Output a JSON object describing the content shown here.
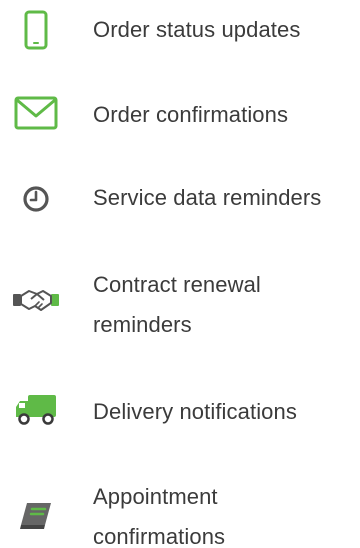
{
  "features": {
    "items": [
      {
        "icon": "smartphone-icon",
        "label": "Order status updates"
      },
      {
        "icon": "envelope-icon",
        "label": "Order confirmations"
      },
      {
        "icon": "clock-icon",
        "label": "Service data reminders"
      },
      {
        "icon": "handshake-icon",
        "label_line1": "Contract renewal",
        "label_line2": "reminders"
      },
      {
        "icon": "truck-icon",
        "label": "Delivery notifications"
      },
      {
        "icon": "book-icon",
        "label_line1": "Appointment",
        "label_line2": "confirmations"
      }
    ]
  },
  "colors": {
    "green": "#5fba47",
    "dark_gray": "#555555",
    "text": "#3b3b3b"
  }
}
